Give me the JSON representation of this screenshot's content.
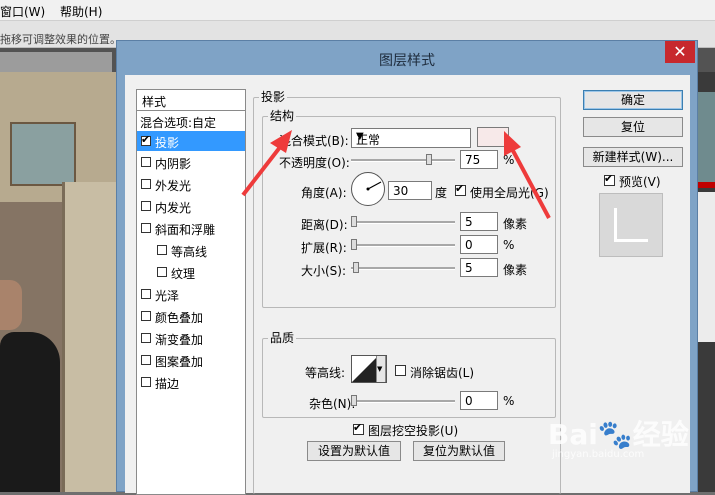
{
  "menu": {
    "window": "窗口(W)",
    "help": "帮助(H)"
  },
  "hint": "拖移可调整效果的位置。",
  "dialog": {
    "title": "图层样式",
    "close": "✕",
    "styles_header": "样式",
    "blend_options": "混合选项:自定",
    "styles": [
      {
        "label": "投影",
        "checked": true,
        "selected": true
      },
      {
        "label": "内阴影",
        "checked": false
      },
      {
        "label": "外发光",
        "checked": false
      },
      {
        "label": "内发光",
        "checked": false
      },
      {
        "label": "斜面和浮雕",
        "checked": false
      },
      {
        "label": "等高线",
        "checked": false
      },
      {
        "label": "纹理",
        "checked": false
      },
      {
        "label": "光泽",
        "checked": false
      },
      {
        "label": "颜色叠加",
        "checked": false
      },
      {
        "label": "渐变叠加",
        "checked": false
      },
      {
        "label": "图案叠加",
        "checked": false
      },
      {
        "label": "描边",
        "checked": false
      }
    ],
    "section_title": "投影",
    "structure": {
      "legend": "结构",
      "blend_mode_label": "混合模式(B):",
      "blend_mode_value": "正常",
      "opacity_label": "不透明度(O):",
      "opacity_value": "75",
      "opacity_unit": "%",
      "opacity_level": 0.75,
      "angle_label": "角度(A):",
      "angle_value": "30",
      "angle_unit": "度",
      "global_light_label": "使用全局光(G)",
      "distance_label": "距离(D):",
      "distance_value": "5",
      "distance_unit": "像素",
      "spread_label": "扩展(R):",
      "spread_value": "0",
      "spread_unit": "%",
      "size_label": "大小(S):",
      "size_value": "5",
      "size_unit": "像素",
      "swatch_color": "#f7e9e9"
    },
    "quality": {
      "legend": "品质",
      "contour_label": "等高线:",
      "anti_alias_label": "消除锯齿(L)",
      "noise_label": "杂色(N):",
      "noise_value": "0",
      "noise_unit": "%"
    },
    "knockout_label": "图层挖空投影(U)",
    "make_default": "设置为默认值",
    "reset_default": "复位为默认值",
    "buttons": {
      "ok": "确定",
      "reset": "复位",
      "new_style": "新建样式(W)...",
      "preview": "预览(V)"
    }
  },
  "watermark": {
    "brand": "Bai🐾经验",
    "url": "jingyan.baidu.com"
  },
  "colors": {
    "accent": "#3399ff",
    "arrow": "#ee3b3b",
    "close": "#c7282d"
  }
}
